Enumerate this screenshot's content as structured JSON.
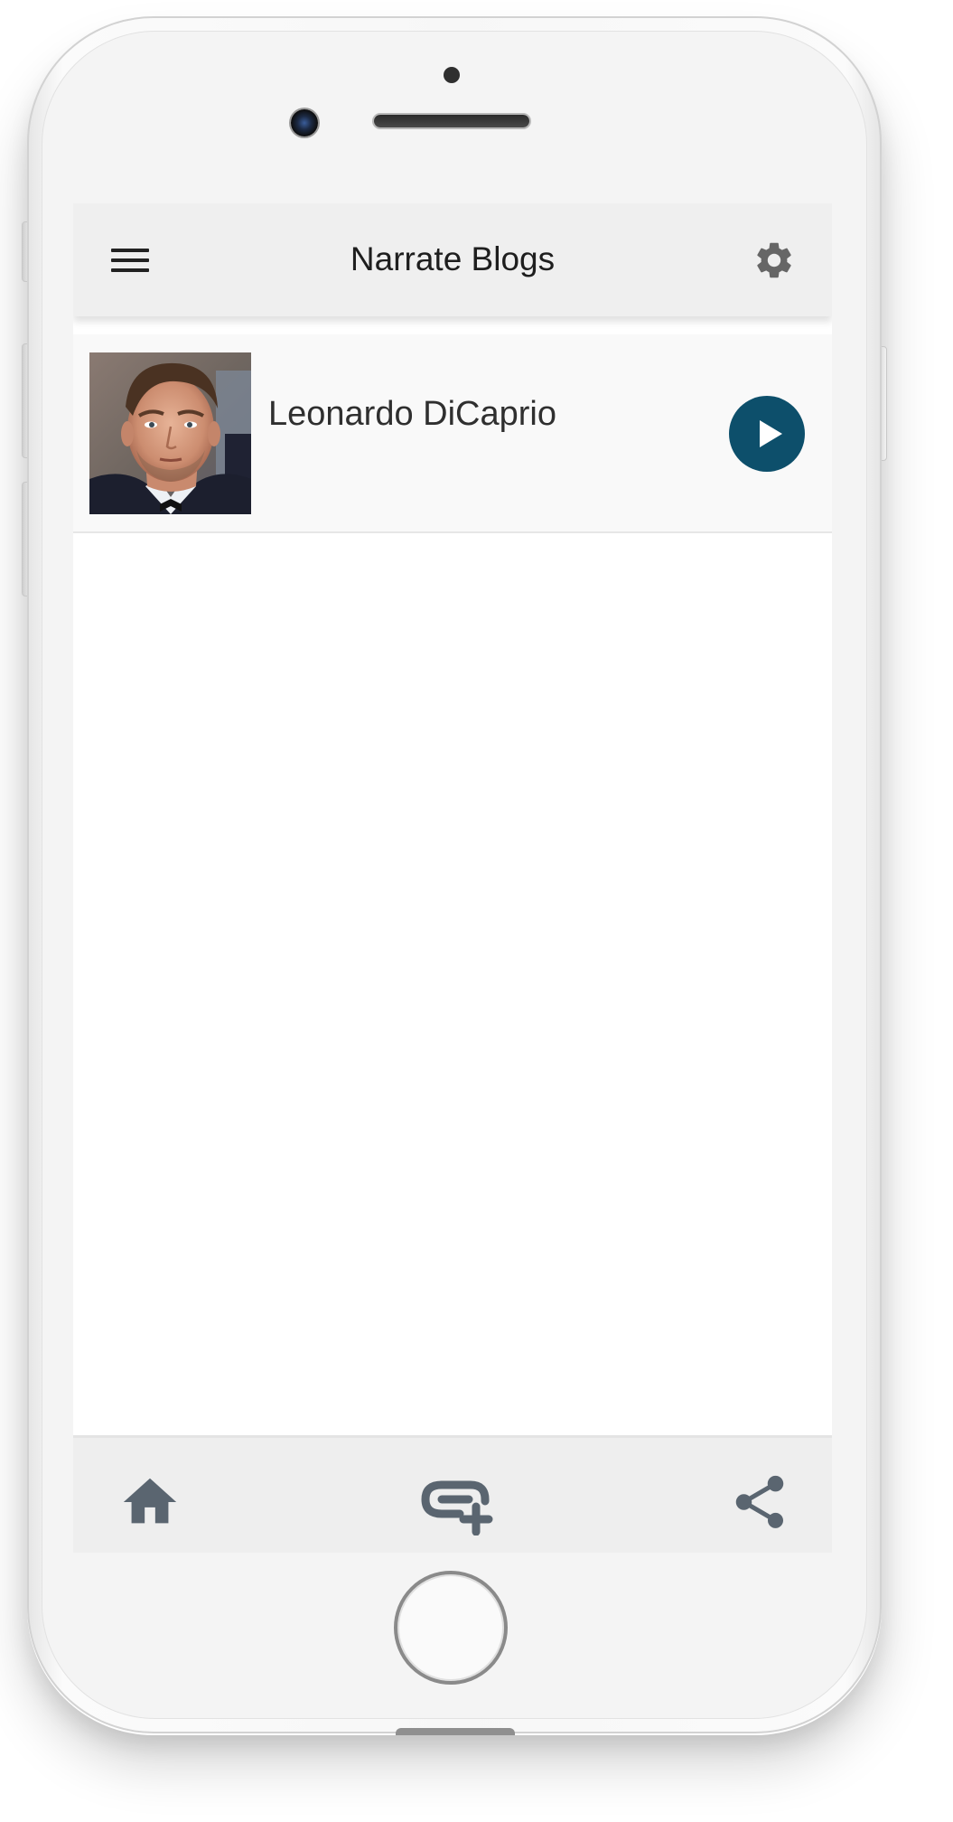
{
  "app": {
    "title": "Narrate Blogs"
  },
  "header": {
    "menu_icon": "menu-icon",
    "settings_icon": "gear-icon"
  },
  "blogs": [
    {
      "title": "Leonardo DiCaprio",
      "thumbnail": "portrait-photo",
      "action_icon": "play-icon"
    }
  ],
  "bottom_nav": {
    "items": [
      {
        "icon": "home-icon"
      },
      {
        "icon": "add-link-icon"
      },
      {
        "icon": "share-icon"
      }
    ]
  },
  "colors": {
    "header_bg": "#efefef",
    "play_button": "#0d4f6b",
    "nav_icon": "#5a6570",
    "settings_icon": "#666666"
  }
}
